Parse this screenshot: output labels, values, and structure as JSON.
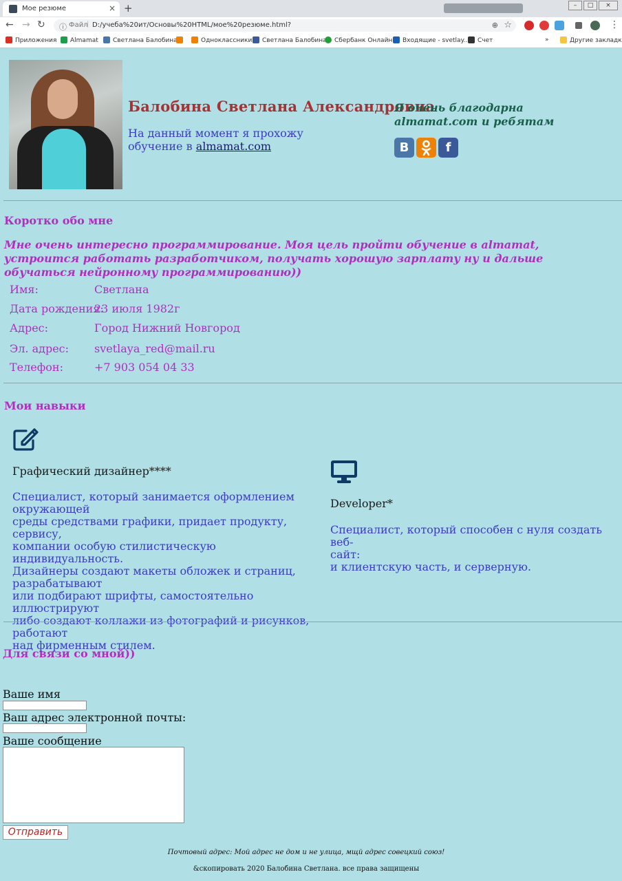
{
  "browser": {
    "tab_title": "Мое резюме",
    "tab_close": "×",
    "new_tab": "+",
    "address_info": "ⓘ",
    "address_file": "Файл",
    "address_sep": "|",
    "url": "D:/учеба%20ит/Основы%20HTML/мое%20резюме.html?",
    "star": "☆",
    "back": "←",
    "forward": "→",
    "reload": "↻",
    "menu": "⋮",
    "win_min": "–",
    "win_max": "□",
    "win_close": "×",
    "bookmarks": [
      {
        "label": "Приложения",
        "color": "#d93025"
      },
      {
        "label": "Almamat",
        "color": "#1a9e4b"
      },
      {
        "label": "Светлана Балобина",
        "color": "#4a76a8"
      },
      {
        "label": "",
        "color": "#ee8208"
      },
      {
        "label": "Одноклассники",
        "color": "#ee8208"
      },
      {
        "label": "Светлана Балобина",
        "color": "#3b5998"
      },
      {
        "label": "Сбербанк Онлайн",
        "color": "#21a038"
      },
      {
        "label": "Входящие - svetlay...",
        "color": "#1a5fb4"
      },
      {
        "label": "Счет",
        "color": "#333333"
      }
    ],
    "bookmarks_more": "»",
    "other_bookmarks": "Другие закладки"
  },
  "header": {
    "name": "Балобина Светлана Александровна",
    "intro_text": "На данный момент я прохожу обучение в ",
    "intro_link": "almamat.com",
    "thanks": "Я очень благодарна almamat.com и ребятам",
    "socials": [
      {
        "icon": "vk-icon",
        "glyph": "B"
      },
      {
        "icon": "odnoklassniki-icon",
        "glyph": "ok"
      },
      {
        "icon": "facebook-icon",
        "glyph": "f"
      }
    ]
  },
  "about": {
    "heading": "Коротко обо мне",
    "text": "Мне очень интересно программирование. Моя цель пройти обучение в almamat, устроится работать разработчиком, получать хорошую зарплату ну и дальше обучаться нейронному программированию))"
  },
  "info": [
    {
      "label": "Имя:",
      "value": "Светлана"
    },
    {
      "label": "Дата рождения:",
      "value": "23 июля 1982г"
    },
    {
      "label": "Адрес:",
      "value": "Город Нижний Новгород"
    },
    {
      "label": "Эл. адрес:",
      "value": "svetlaya_red@mail.ru"
    },
    {
      "label": "Телефон:",
      "value": "+7 903 054 04 33"
    }
  ],
  "skills": {
    "heading": "Мои навыки",
    "items": [
      {
        "icon": "edit-icon",
        "title": "Графический дизайнер****",
        "lines": [
          "Специалист, который занимается оформлением окружающей",
          "среды средствами графики, придает продукту, сервису,",
          "компании особую стилистическую индивидуальность.",
          "Дизайнеры создают макеты обложек и страниц,",
          "разрабатывают",
          "или подбирают шрифты, самостоятельно иллюстрируют",
          "либо создают коллажи из фотографий и рисунков, работают",
          "над фирменным стилем."
        ]
      },
      {
        "icon": "monitor-icon",
        "title": "Developer*",
        "lines": [
          "Специалист, который способен с нуля создать веб-",
          "сайт:",
          "и клиентскую часть, и серверную."
        ]
      }
    ]
  },
  "contact": {
    "heading": "Для связи со мной))",
    "name_label": "Ваше имя",
    "email_label": "Ваш адрес электронной почты:",
    "message_label": "Ваше сообщение",
    "submit": "Отправить"
  },
  "footer": {
    "address": "Почтовый адрес: Мой адрес не дом и не улица, мщй адрес совецкий союз!",
    "copyright": "&скопировать 2020 Балобина Светлана. все права защищены"
  },
  "colors": {
    "page_bg": "#b0dfe5",
    "name": "#a53333",
    "accent": "#b02fbf",
    "link_text": "#3c3cc4",
    "thanks": "#19604a",
    "icon": "#0d3b66"
  }
}
